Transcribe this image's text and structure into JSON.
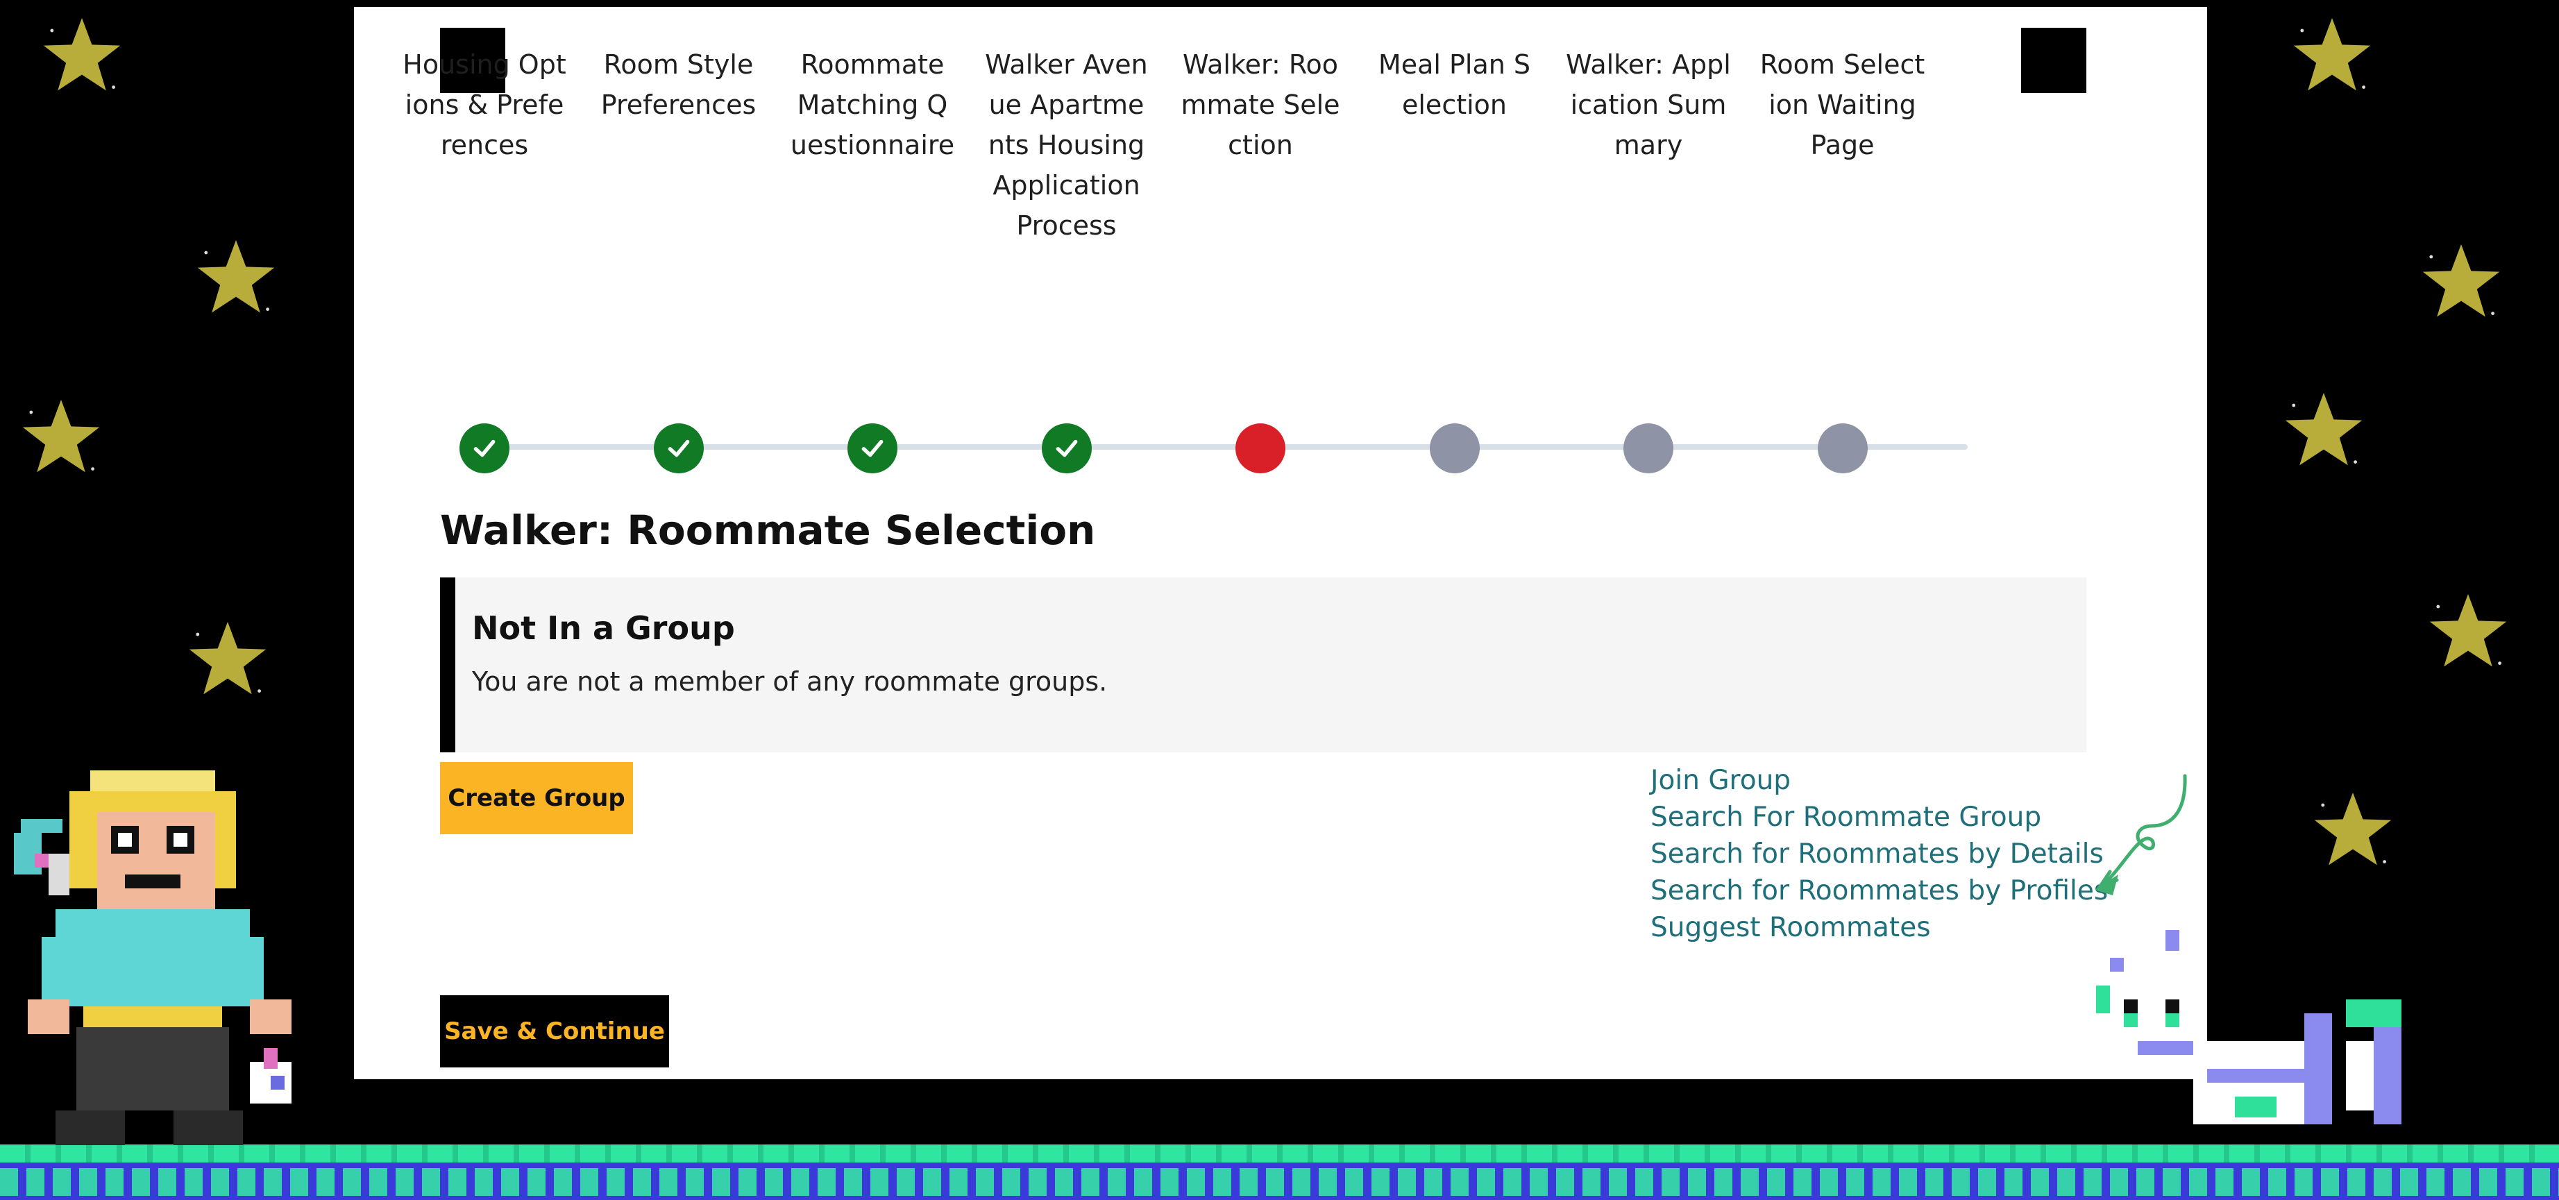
{
  "progress": {
    "steps": [
      {
        "label": "Housing Options & Preferences",
        "status": "done"
      },
      {
        "label": "Room Style Preferences",
        "status": "done"
      },
      {
        "label": "Roommate Matching Questionnaire",
        "status": "done"
      },
      {
        "label": "Walker Avenue Apartments Housing Application Process",
        "status": "done"
      },
      {
        "label": "Walker: Roommate Selection",
        "status": "current"
      },
      {
        "label": "Meal Plan Selection",
        "status": "todo"
      },
      {
        "label": "Walker: Application Summary",
        "status": "todo"
      },
      {
        "label": "Room Selection Waiting Page",
        "status": "todo"
      }
    ],
    "colors": {
      "done": "#117a25",
      "current": "#d92028",
      "todo": "#8e93a5",
      "track": "#d7e0e6"
    }
  },
  "page": {
    "title": "Walker: Roommate Selection"
  },
  "alert": {
    "title": "Not In a Group",
    "body": "You are not a member of any roommate groups."
  },
  "actions": {
    "create_group": "Create Group",
    "save_continue": "Save & Continue"
  },
  "links": [
    "Join Group",
    "Search For Roommate Group",
    "Search for Roommates by Details",
    "Search for Roommates by Profiles",
    "Suggest Roommates"
  ],
  "icons": {
    "nav_prev": "nav-prev-icon",
    "nav_next": "nav-next-icon",
    "check": "check-icon",
    "star": "star-icon",
    "arrow": "curly-arrow-icon"
  },
  "theme": {
    "accent": "#fbb424",
    "link": "#1f6f7a",
    "background": "#000000",
    "star": "#b8ac3a"
  }
}
